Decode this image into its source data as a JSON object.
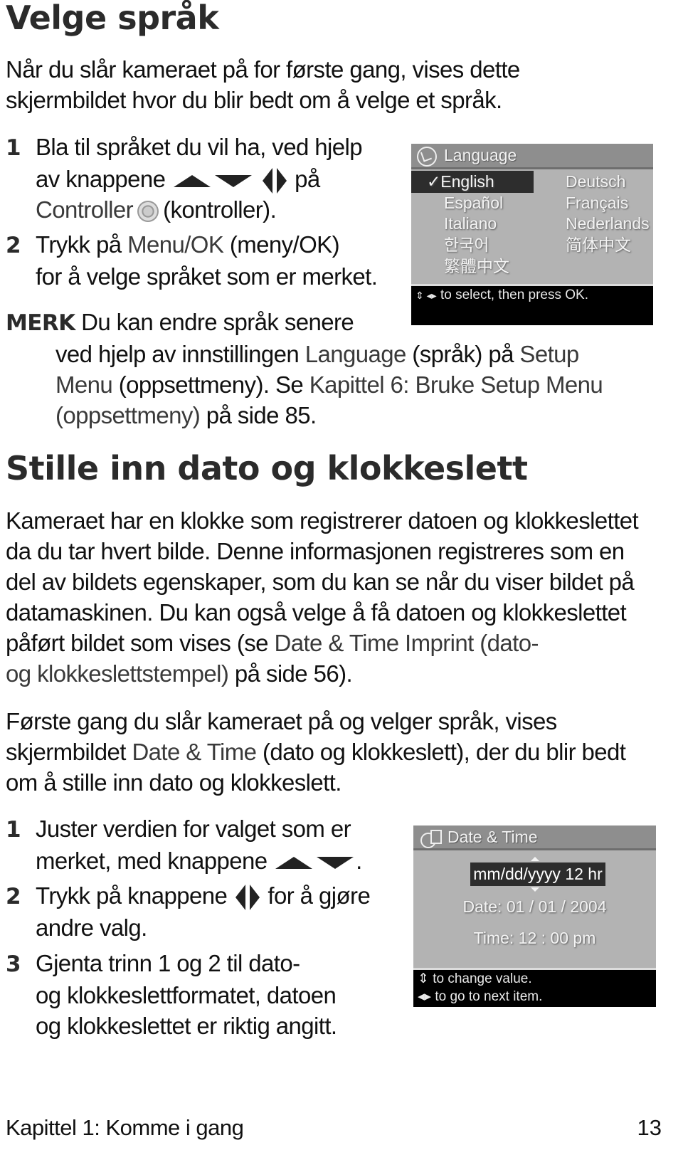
{
  "section1": {
    "title": "Velge språk",
    "intro": [
      "Når du slår kameraet på for første gang, vises dette",
      "skjermbildet hvor du blir bedt om å velge et språk."
    ],
    "steps": [
      {
        "number": "1",
        "lines": [
          "Bla til språket du vil ha, ved hjelp",
          "av knappene",
          "på",
          "Controller",
          "(kontroller)."
        ],
        "icons": [
          "up-arrow-button-icon",
          "down-arrow-button-icon",
          "left-arrow-button-icon",
          "right-arrow-button-icon",
          "controller-icon"
        ]
      },
      {
        "number": "2",
        "text_pre": "Trykk på ",
        "ui_ref": "Menu/OK",
        "text_post": " (meny/OK)",
        "line2": "for å velge språket som er merket."
      }
    ],
    "note": {
      "label": "MERK",
      "line1": "Du kan endre språk senere",
      "line2_pre": "ved hjelp av innstillingen ",
      "line2_ref1": "Language",
      "line2_mid": " (språk) på ",
      "line2_ref2": "Setup",
      "line3_ref1": "Menu",
      "line3_mid": " (oppsettmeny). Se ",
      "line3_ref2": "Kapittel 6: Bruke Setup Menu",
      "line4_ref": "(oppsettmeny)",
      "line4_post": " på side 85."
    },
    "screen": {
      "title": "Language",
      "icon": "globe-icon",
      "selected_mark": "✓",
      "left_column": [
        "English",
        "Español",
        "Italiano",
        "한국어",
        "繁體中文"
      ],
      "right_column": [
        "Deutsch",
        "Français",
        "Nederlands",
        "简体中文"
      ],
      "selected": "English",
      "footer_glyphs": "⇕ ◂▸",
      "footer_text": "to select, then press OK."
    }
  },
  "section2": {
    "title": "Stille inn dato og klokkeslett",
    "para1": [
      "Kameraet har en klokke som registrerer datoen og klokkeslettet",
      "da du tar hvert bilde. Denne informasjonen registreres som en",
      "del av bildets egenskaper, som du kan se når du viser bildet på",
      "datamaskinen. Du kan også velge å få datoen og klokkeslettet"
    ],
    "para1_line5_pre": "påført bildet som vises (se ",
    "para1_line5_ref": "Date & Time Imprint (dato-",
    "para1_line6_ref": "og klokkeslettstempel)",
    "para1_line6_post": " på side 56).",
    "para2_line1": "Første gang du slår kameraet på og velger språk, vises",
    "para2_line2_pre": "skjermbildet ",
    "para2_line2_ref": "Date & Time",
    "para2_line2_post": " (dato og klokkeslett), der du blir bedt",
    "para2_line3": "om å stille inn dato og klokkeslett.",
    "steps": [
      {
        "number": "1",
        "line1": "Juster verdien for valget som er",
        "line2": "merket, med knappene"
      },
      {
        "number": "2",
        "line1_pre": "Trykk på knappene",
        "line1_post": "for å gjøre",
        "line2": "andre valg."
      },
      {
        "number": "3",
        "line1": "Gjenta trinn 1 og 2 til dato-",
        "line2": "og klokkeslettformatet, datoen",
        "line3": "og klokkeslettet er riktig angitt."
      }
    ],
    "screen": {
      "title": "Date & Time",
      "icon": "clock-calendar-icon",
      "format": "mm/dd/yyyy  12 hr",
      "date": "Date:  01 / 01 / 2004",
      "time": "Time:  12 : 00  pm",
      "footer_line1": "⇕ to change value.",
      "footer_line2": "◂▸ to go to next item."
    }
  },
  "footer": {
    "chapter": "Kapittel 1: Komme i gang",
    "page_number": "13"
  }
}
